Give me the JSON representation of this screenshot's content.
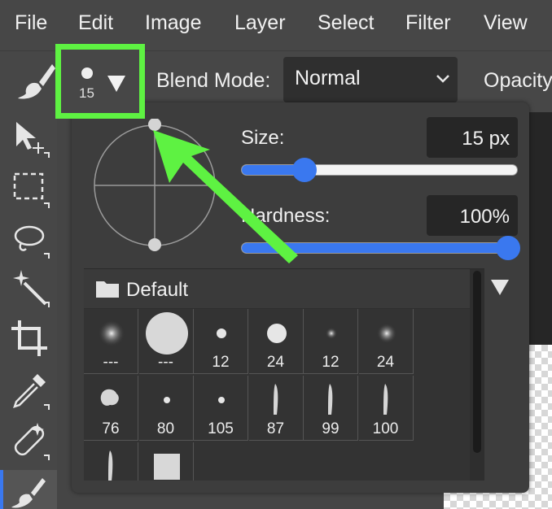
{
  "menubar": {
    "items": [
      "File",
      "Edit",
      "Image",
      "Layer",
      "Select",
      "Filter",
      "View"
    ]
  },
  "options": {
    "brush_size_label": "15",
    "blend_mode_label": "Blend Mode:",
    "blend_mode_value": "Normal",
    "opacity_label": "Opacity"
  },
  "popup": {
    "size_label": "Size:",
    "size_value": "15  px",
    "size_fraction": 0.23,
    "hardness_label": "Hardness:",
    "hardness_value": "100%",
    "hardness_fraction": 1.0
  },
  "brush_list": {
    "folder_label": "Default",
    "presets": [
      {
        "label": "---",
        "kind": "soft-large"
      },
      {
        "label": "---",
        "kind": "hard-large"
      },
      {
        "label": "12",
        "kind": "hard-small"
      },
      {
        "label": "24",
        "kind": "hard-medium"
      },
      {
        "label": "12",
        "kind": "soft-small"
      },
      {
        "label": "24",
        "kind": "soft-medium"
      },
      {
        "label": "76",
        "kind": "splatter"
      },
      {
        "label": "80",
        "kind": "dot"
      },
      {
        "label": "105",
        "kind": "dot"
      },
      {
        "label": "87",
        "kind": "stroke"
      },
      {
        "label": "99",
        "kind": "stroke"
      },
      {
        "label": "100",
        "kind": "stroke"
      },
      {
        "label": "",
        "kind": "stroke"
      },
      {
        "label": "",
        "kind": "square"
      }
    ]
  },
  "annotation": {
    "color": "#5ef242"
  }
}
